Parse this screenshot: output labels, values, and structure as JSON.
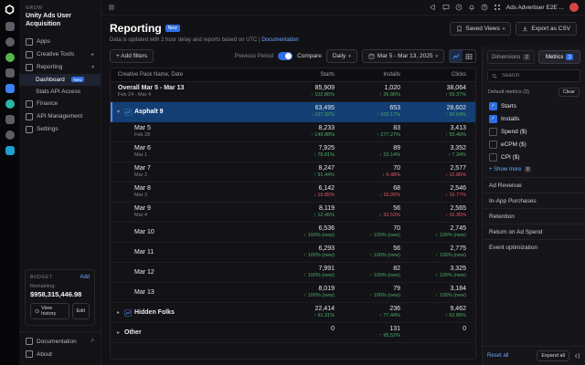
{
  "colors": {
    "accent": "#2f6fe4",
    "positive": "#4cae5e",
    "negative": "#e15b5e",
    "selected_row": "#123e74"
  },
  "rail": {
    "icons": [
      {
        "name": "rail-product-icon-1",
        "color": "#5c5d66",
        "shape": "square"
      },
      {
        "name": "rail-product-icon-2",
        "color": "#5c5d66",
        "shape": "circle"
      },
      {
        "name": "rail-product-icon-3",
        "color": "#56b44c",
        "shape": "circle"
      },
      {
        "name": "rail-product-icon-4",
        "color": "#5c5d66",
        "shape": "square"
      },
      {
        "name": "rail-product-icon-5",
        "color": "#3b82f6",
        "shape": "square"
      },
      {
        "name": "rail-product-icon-6",
        "color": "#2ab5a5",
        "shape": "circle"
      },
      {
        "name": "rail-product-icon-7",
        "color": "#5c5d66",
        "shape": "square"
      },
      {
        "name": "rail-product-icon-8",
        "color": "#5c5d66",
        "shape": "circle"
      },
      {
        "name": "rail-product-icon-9",
        "color": "#1f9fd0",
        "shape": "square"
      }
    ]
  },
  "sidebar": {
    "org_label": "GROW",
    "org_name": "Unity Ads User Acquisition",
    "items": [
      {
        "label": "Apps",
        "icon": "apps-icon"
      },
      {
        "label": "Creative Tools",
        "icon": "creative-tools-icon",
        "chevron": "right"
      },
      {
        "label": "Reporting",
        "icon": "reporting-icon",
        "chevron": "down"
      },
      {
        "label": "Dashboard",
        "indent": 1,
        "badge": "New",
        "selected": true
      },
      {
        "label": "Stats API Access",
        "indent": 1
      },
      {
        "label": "Finance",
        "icon": "finance-icon"
      },
      {
        "label": "API Management",
        "icon": "api-icon"
      },
      {
        "label": "Settings",
        "icon": "settings-icon"
      }
    ],
    "budget": {
      "label": "BUDGET",
      "add_label": "Add",
      "remaining_label": "Remaining:",
      "amount": "$958,315,446.98",
      "view_history_label": "View history",
      "edit_label": "Edit"
    },
    "footer": {
      "documentation": "Documentation",
      "about": "About"
    }
  },
  "topbar": {
    "org": "Ads Advertiser E2E ..."
  },
  "page": {
    "title": "Reporting",
    "badge": "New",
    "subtitle": "Data is updated with 2 hour delay and reports based on UTC",
    "divider": "|",
    "doc_link": "Documentation",
    "saved_views": "Saved Views",
    "export_csv": "Export as CSV"
  },
  "filters": {
    "add_filters": "+ Add filters",
    "previous_period": "Previous Period",
    "compare": "Compare",
    "granularity": "Daily",
    "date_range": "Mar 5 - Mar 13, 2025"
  },
  "table": {
    "columns": [
      "Creative Pack Name, Date",
      "Starts",
      "Installs",
      "Clicks"
    ],
    "rows": [
      {
        "kind": "overall",
        "name": "Overall Mar 5 - Mar 13",
        "sub": "Feb 24 - Mar 4",
        "cells": [
          {
            "v": "85,909",
            "pct": "102.86%",
            "dir": "up"
          },
          {
            "v": "1,020",
            "pct": "26.86%",
            "dir": "up"
          },
          {
            "v": "38,064",
            "pct": "69.37%",
            "dir": "up"
          }
        ]
      },
      {
        "kind": "group",
        "name": "Asphalt 9",
        "chevron": "down",
        "chart_icon": true,
        "selected": true,
        "cells": [
          {
            "v": "63,495",
            "pct": "107.32%",
            "dir": "up"
          },
          {
            "v": "653",
            "pct": "102.17%",
            "dir": "up"
          },
          {
            "v": "28,602",
            "pct": "90.64%",
            "dir": "up"
          }
        ]
      },
      {
        "kind": "date",
        "name": "Mar 5",
        "sub": "Feb 28",
        "cells": [
          {
            "v": "8,233",
            "pct": "149.88%",
            "dir": "up"
          },
          {
            "v": "83",
            "pct": "277.27%",
            "dir": "up"
          },
          {
            "v": "3,413",
            "pct": "55.49%",
            "dir": "up"
          }
        ]
      },
      {
        "kind": "date",
        "name": "Mar 6",
        "sub": "Mar 1",
        "cells": [
          {
            "v": "7,925",
            "pct": "78.81%",
            "dir": "up"
          },
          {
            "v": "89",
            "pct": "23.14%",
            "dir": "up"
          },
          {
            "v": "3,352",
            "pct": "7.34%",
            "dir": "up"
          }
        ]
      },
      {
        "kind": "date",
        "name": "Mar 7",
        "sub": "Mar 2",
        "cells": [
          {
            "v": "8,247",
            "pct": "91.44%",
            "dir": "up"
          },
          {
            "v": "70",
            "pct": "6.48%",
            "dir": "down"
          },
          {
            "v": "2,577",
            "pct": "15.86%",
            "dir": "down"
          }
        ]
      },
      {
        "kind": "date",
        "name": "Mar 8",
        "sub": "Mar 3",
        "cells": [
          {
            "v": "6,142",
            "pct": "19.85%",
            "dir": "down"
          },
          {
            "v": "68",
            "pct": "16.05%",
            "dir": "down"
          },
          {
            "v": "2,546",
            "pct": "16.77%",
            "dir": "down"
          }
        ]
      },
      {
        "kind": "date",
        "name": "Mar 9",
        "sub": "Mar 4",
        "cells": [
          {
            "v": "8,119",
            "pct": "12.45%",
            "dir": "up"
          },
          {
            "v": "56",
            "pct": "32.53%",
            "dir": "down"
          },
          {
            "v": "2,565",
            "pct": "16.35%",
            "dir": "down"
          }
        ]
      },
      {
        "kind": "date",
        "name": "Mar 10",
        "cells": [
          {
            "v": "6,536",
            "pct": "100%",
            "dir": "up",
            "new": true
          },
          {
            "v": "70",
            "pct": "100%",
            "dir": "up",
            "new": true
          },
          {
            "v": "2,745",
            "pct": "100%",
            "dir": "up",
            "new": true
          }
        ]
      },
      {
        "kind": "date",
        "name": "Mar 11",
        "cells": [
          {
            "v": "6,293",
            "pct": "100%",
            "dir": "up",
            "new": true
          },
          {
            "v": "56",
            "pct": "100%",
            "dir": "up",
            "new": true
          },
          {
            "v": "2,775",
            "pct": "100%",
            "dir": "up",
            "new": true
          }
        ]
      },
      {
        "kind": "date",
        "name": "Mar 12",
        "cells": [
          {
            "v": "7,991",
            "pct": "100%",
            "dir": "up",
            "new": true
          },
          {
            "v": "82",
            "pct": "100%",
            "dir": "up",
            "new": true
          },
          {
            "v": "3,325",
            "pct": "100%",
            "dir": "up",
            "new": true
          }
        ]
      },
      {
        "kind": "date",
        "name": "Mar 13",
        "cells": [
          {
            "v": "8,019",
            "pct": "100%",
            "dir": "up",
            "new": true
          },
          {
            "v": "79",
            "pct": "100%",
            "dir": "up",
            "new": true
          },
          {
            "v": "3,184",
            "pct": "100%",
            "dir": "up",
            "new": true
          }
        ]
      },
      {
        "kind": "group",
        "name": "Hidden Folks",
        "chevron": "right",
        "chart_icon": true,
        "cells": [
          {
            "v": "22,414",
            "pct": "91.31%",
            "dir": "up"
          },
          {
            "v": "236",
            "pct": "77.44%",
            "dir": "up"
          },
          {
            "v": "9,462",
            "pct": "62.86%",
            "dir": "up"
          }
        ]
      },
      {
        "kind": "group",
        "name": "Other",
        "chevron": "right",
        "cells": [
          {
            "v": "0"
          },
          {
            "v": "131",
            "pct": "95.52%",
            "dir": "up"
          },
          {
            "v": "0"
          }
        ]
      }
    ]
  },
  "panel": {
    "tabs": [
      {
        "label": "Dimensions",
        "count": "2",
        "active": false
      },
      {
        "label": "Metrics",
        "count": "3",
        "active": true
      }
    ],
    "search_placeholder": "Search",
    "default_label": "Default metrics (3)",
    "clear_label": "Clear",
    "metrics": [
      {
        "label": "Starts",
        "checked": true
      },
      {
        "label": "Installs",
        "checked": true
      },
      {
        "label": "Spend ($)",
        "checked": false
      },
      {
        "label": "eCPM ($)",
        "checked": false
      },
      {
        "label": "CPI ($)",
        "checked": false
      }
    ],
    "show_more_label": "+ Show more",
    "show_more_count": "8",
    "sections": [
      "Ad Revenue",
      "In-App Purchases",
      "Retention",
      "Return on Ad Spend",
      "Event optimization"
    ],
    "reset_label": "Reset all",
    "expand_label": "Expand all"
  }
}
